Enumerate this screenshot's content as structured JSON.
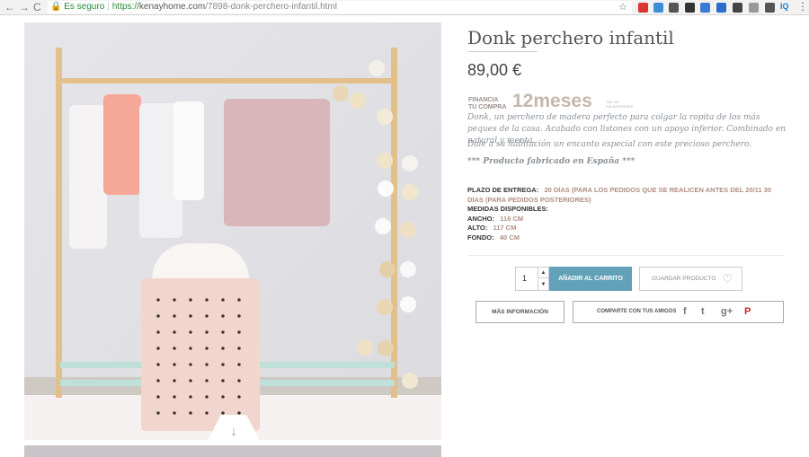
{
  "browser": {
    "back": "←",
    "forward": "→",
    "reload": "C",
    "secure_label": "Es seguro",
    "url_scheme": "https://",
    "url_host": "kenayhome.com",
    "url_path": "/7898-donk-perchero-infantil.html",
    "star": "☆",
    "menu": "⋮",
    "extension_badge": "IQ"
  },
  "product": {
    "title": "Donk perchero infantil",
    "price": "89,00 €",
    "financing": {
      "line1": "FINANCIA",
      "line2": "TU COMPRA",
      "big": "12meses",
      "tiny1": "TAE 0%",
      "tiny2": "SIN INTERESES"
    },
    "description": "Donk, un perchero de madera perfecto para colgar la ropita de los más peques de la casa. Acabado con listones con un apoyo inferior. Combinado en natural y menta.",
    "description2": "Dale a su habitación un encanto especial con este precioso perchero.",
    "made_in": "*** Producto fabricado en España ***",
    "specs": {
      "delivery_label": "PLAZO DE ENTREGA:",
      "delivery_value": "20 DÍAS (PARA LOS PEDIDOS QUE SE REALICEN ANTES DEL 20/11 30 DÍAS (PARA PEDIDOS POSTERIORES)",
      "measures_label": "MEDIDAS DISPONIBLES:",
      "width_label": "ANCHO:",
      "width_value": "116 CM",
      "height_label": "ALTO:",
      "height_value": "117 CM",
      "depth_label": "FONDO:",
      "depth_value": "40 CM"
    }
  },
  "actions": {
    "quantity": "1",
    "qty_up": "▲",
    "qty_down": "▼",
    "add_to_cart": "AÑADIR AL CARRITO",
    "save_product": "GUARDAR PRODUCTO",
    "heart": "♡",
    "more_info": "MÁS INFORMACIÓN",
    "share_label": "COMPARTE CON TUS AMIGOS",
    "facebook": "f",
    "twitter": "t",
    "googleplus": "g+",
    "pinterest": "P"
  },
  "gallery": {
    "scroll_arrow": "↓"
  },
  "colors": {
    "accent": "#62a1b7",
    "secure": "#2a8a38",
    "spec_value": "#b08f80"
  }
}
